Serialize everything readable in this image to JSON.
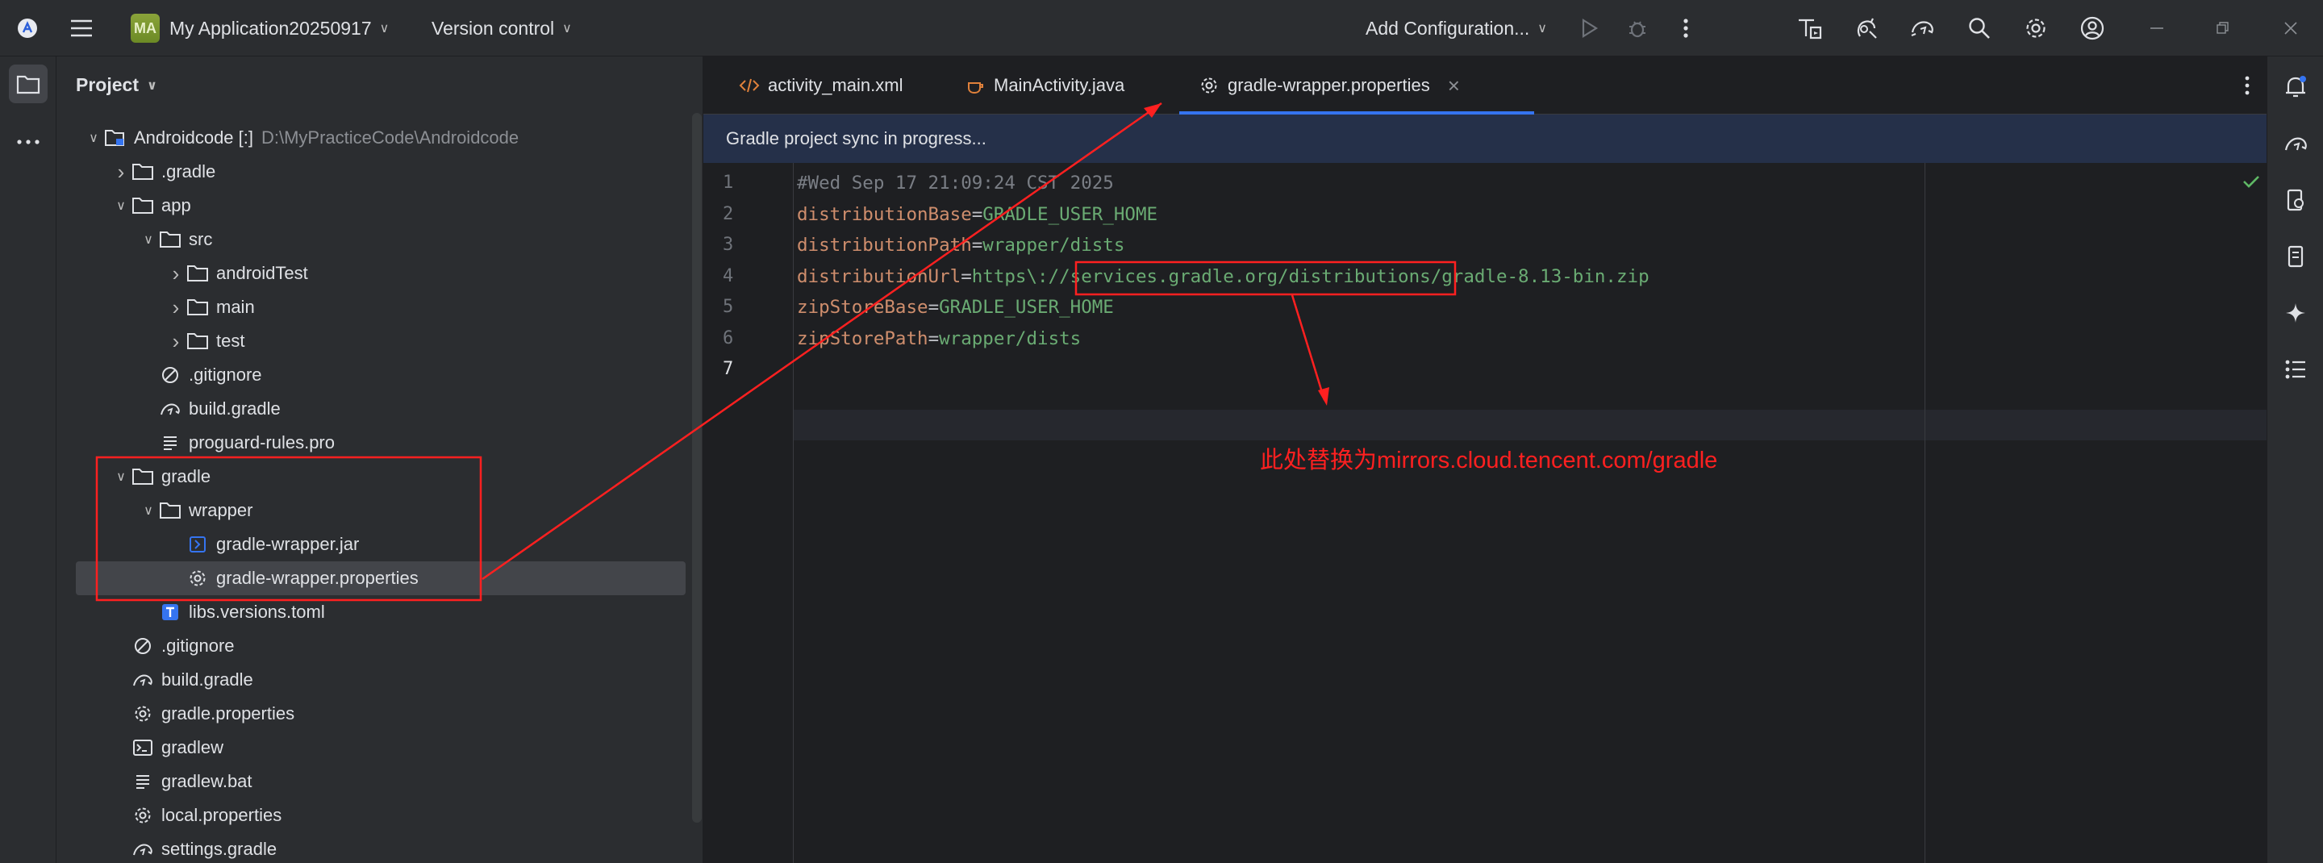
{
  "titlebar": {
    "project_badge": "MA",
    "project_name": "My Application20250917",
    "vcs": "Version control",
    "run_config": "Add Configuration..."
  },
  "project_panel": {
    "title": "Project",
    "tree": [
      {
        "label": "Androidcode [:]",
        "suffix": "D:\\MyPracticeCode\\Androidcode",
        "type": "module",
        "level": 0,
        "expanded": true
      },
      {
        "label": ".gradle",
        "type": "folder",
        "level": 1,
        "expanded": false
      },
      {
        "label": "app",
        "type": "folder",
        "level": 1,
        "expanded": true
      },
      {
        "label": "src",
        "type": "folder",
        "level": 2,
        "expanded": true
      },
      {
        "label": "androidTest",
        "type": "folder",
        "level": 3,
        "expanded": false
      },
      {
        "label": "main",
        "type": "folder",
        "level": 3,
        "expanded": false
      },
      {
        "label": "test",
        "type": "folder",
        "level": 3,
        "expanded": false
      },
      {
        "label": ".gitignore",
        "type": "ignore",
        "level": 2
      },
      {
        "label": "build.gradle",
        "type": "gradle",
        "level": 2
      },
      {
        "label": "proguard-rules.pro",
        "type": "text",
        "level": 2
      },
      {
        "label": "gradle",
        "type": "folder",
        "level": 1,
        "expanded": true
      },
      {
        "label": "wrapper",
        "type": "folder",
        "level": 2,
        "expanded": true
      },
      {
        "label": "gradle-wrapper.jar",
        "type": "jar",
        "level": 3
      },
      {
        "label": "gradle-wrapper.properties",
        "type": "settings",
        "level": 3,
        "selected": true
      },
      {
        "label": "libs.versions.toml",
        "type": "toml",
        "level": 2
      },
      {
        "label": ".gitignore",
        "type": "ignore",
        "level": 1
      },
      {
        "label": "build.gradle",
        "type": "gradle",
        "level": 1
      },
      {
        "label": "gradle.properties",
        "type": "settings",
        "level": 1
      },
      {
        "label": "gradlew",
        "type": "terminal",
        "level": 1
      },
      {
        "label": "gradlew.bat",
        "type": "text",
        "level": 1
      },
      {
        "label": "local.properties",
        "type": "settings",
        "level": 1
      },
      {
        "label": "settings.gradle",
        "type": "gradle",
        "level": 1
      }
    ]
  },
  "editor": {
    "tabs": [
      {
        "label": "activity_main.xml",
        "icon": "xml-icon"
      },
      {
        "label": "MainActivity.java",
        "icon": "java-icon"
      },
      {
        "label": "gradle-wrapper.properties",
        "icon": "settings-icon",
        "active": true
      }
    ],
    "sync_banner": "Gradle project sync in progress...",
    "lines": [
      {
        "n": "1",
        "parts": [
          {
            "t": "#Wed Sep 17 21:09:24 CST 2025",
            "c": "cm"
          }
        ]
      },
      {
        "n": "2",
        "parts": [
          {
            "t": "distributionBase",
            "c": "k"
          },
          {
            "t": "=",
            "c": "eq"
          },
          {
            "t": "GRADLE_USER_HOME",
            "c": "v"
          }
        ]
      },
      {
        "n": "3",
        "parts": [
          {
            "t": "distributionPath",
            "c": "k"
          },
          {
            "t": "=",
            "c": "eq"
          },
          {
            "t": "wrapper/dists",
            "c": "v"
          }
        ]
      },
      {
        "n": "4",
        "parts": [
          {
            "t": "distributionUrl",
            "c": "k"
          },
          {
            "t": "=",
            "c": "eq"
          },
          {
            "t": "https\\://services.gradle.org/distributions/gradle-8.13-bin.zip",
            "c": "v"
          }
        ]
      },
      {
        "n": "5",
        "parts": [
          {
            "t": "zipStoreBase",
            "c": "k"
          },
          {
            "t": "=",
            "c": "eq"
          },
          {
            "t": "GRADLE_USER_HOME",
            "c": "v"
          }
        ]
      },
      {
        "n": "6",
        "parts": [
          {
            "t": "zipStorePath",
            "c": "k"
          },
          {
            "t": "=",
            "c": "eq"
          },
          {
            "t": "wrapper/dists",
            "c": "v"
          }
        ]
      },
      {
        "n": "7",
        "parts": []
      }
    ]
  },
  "annotation": {
    "text": "此处替换为mirrors.cloud.tencent.com/gradle",
    "color": "#ff2020"
  }
}
